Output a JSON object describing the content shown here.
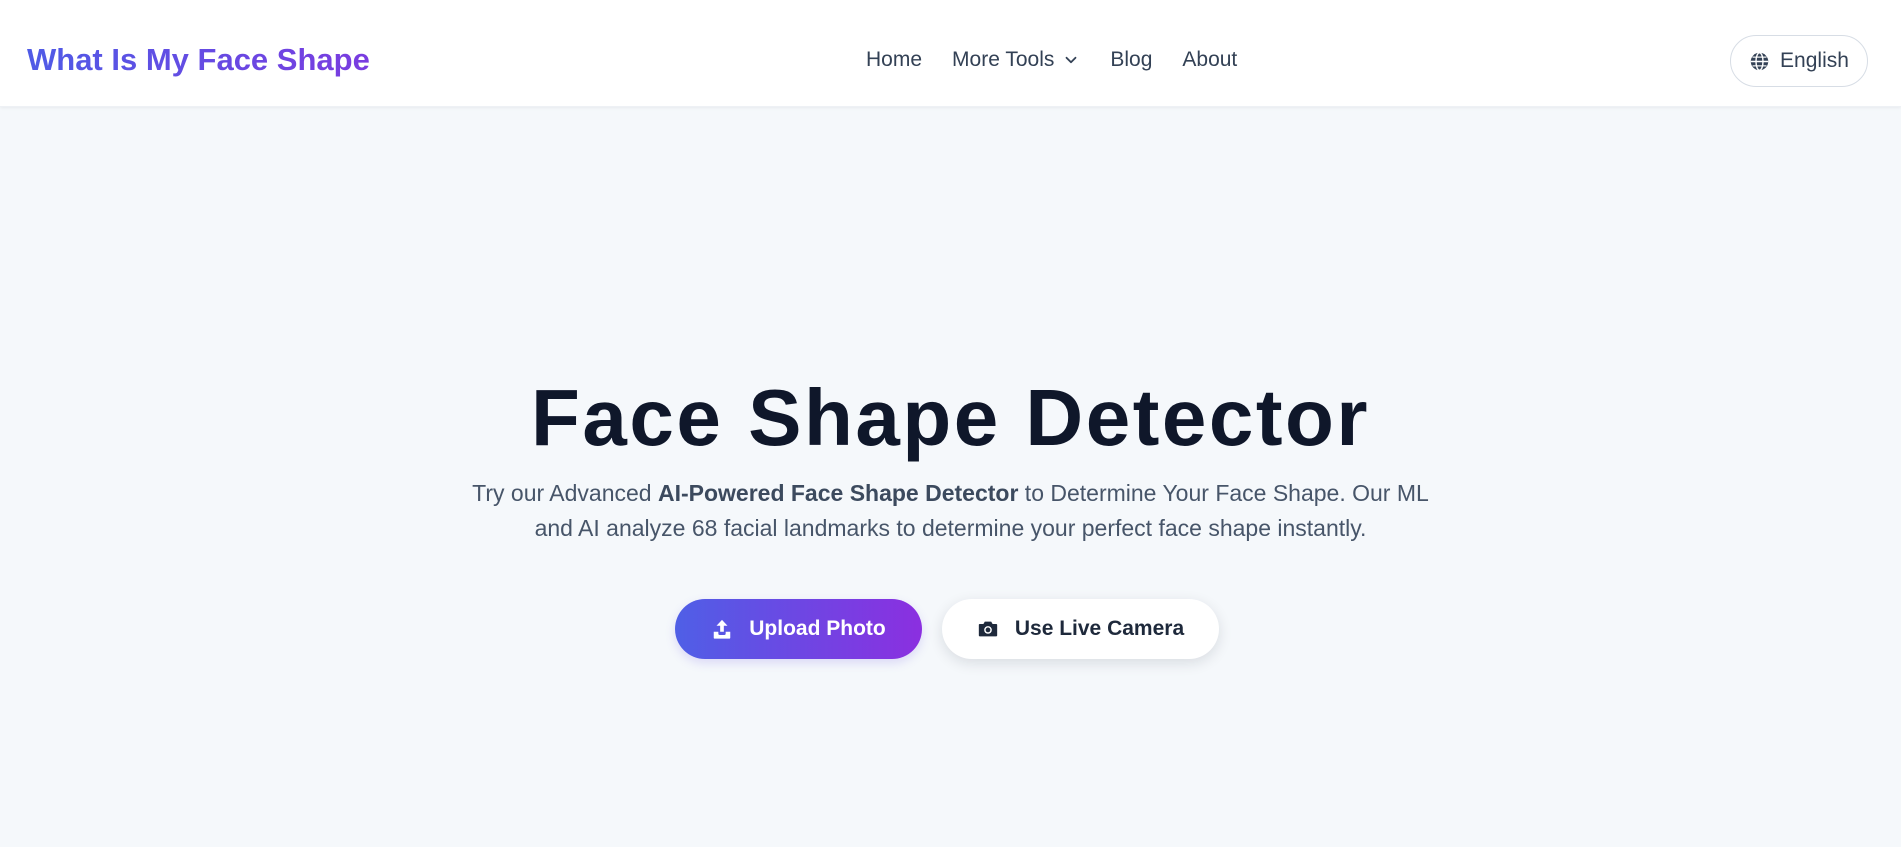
{
  "header": {
    "logo_text": "What Is My Face Shape",
    "nav": [
      {
        "label": "Home"
      },
      {
        "label": "More Tools",
        "icon": "chevron-down-icon"
      },
      {
        "label": "Blog"
      },
      {
        "label": "About"
      }
    ],
    "language": {
      "label": "English",
      "icon": "globe-icon"
    }
  },
  "hero": {
    "title": "Face Shape Detector",
    "desc_prefix": "Try our Advanced ",
    "desc_bold": "AI-Powered Face Shape Detector",
    "desc_suffix": " to Determine Your Face Shape. Our ML and AI analyze 68 facial landmarks to determine your perfect face shape instantly.",
    "upload_button": {
      "label": "Upload Photo",
      "icon": "upload-icon"
    },
    "camera_button": {
      "label": "Use Live Camera",
      "icon": "camera-icon"
    }
  },
  "colors": {
    "brand_gradient_start": "#4f5be6",
    "brand_gradient_end": "#8b2fe0",
    "page_background": "#f5f8fb",
    "heading": "#0f172a"
  }
}
